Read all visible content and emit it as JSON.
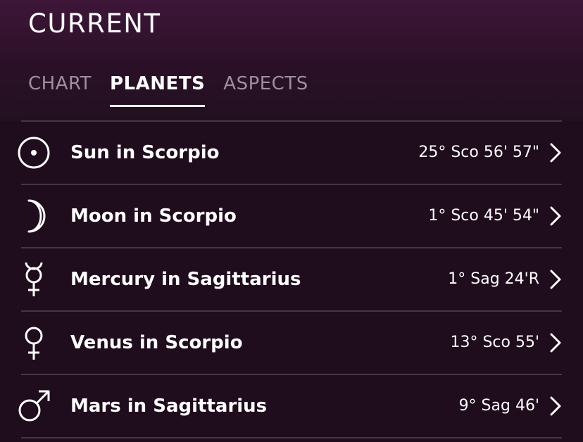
{
  "header": {
    "title": "CURRENT",
    "tabs": [
      {
        "label": "CHART",
        "active": false
      },
      {
        "label": "PLANETS",
        "active": true
      },
      {
        "label": "ASPECTS",
        "active": false
      }
    ]
  },
  "planets": [
    {
      "name": "Sun in Scorpio",
      "position": "25° Sco 56' 57\"",
      "icon": "sun-icon"
    },
    {
      "name": "Moon in Scorpio",
      "position": "1° Sco 45' 54\"",
      "icon": "moon-icon"
    },
    {
      "name": "Mercury in Sagittarius",
      "position": "1° Sag 24'R",
      "icon": "mercury-icon"
    },
    {
      "name": "Venus in Scorpio",
      "position": "13° Sco 55'",
      "icon": "venus-icon"
    },
    {
      "name": "Mars in Sagittarius",
      "position": "9° Sag 46'",
      "icon": "mars-icon"
    }
  ],
  "colors": {
    "background": "#1f0c1c",
    "header_top": "#3e1638",
    "inactive_tab": "#9f8e9c",
    "divider": "#4a3346",
    "text": "#ffffff"
  }
}
